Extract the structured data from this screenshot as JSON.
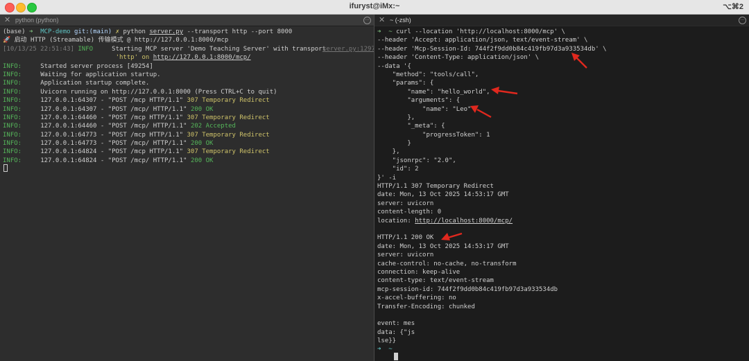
{
  "window": {
    "title": "ifuryst@iMx:~",
    "shortcut": "⌥⌘2"
  },
  "tabs": {
    "left": {
      "close": "✕",
      "label": "python (python)",
      "more": "···"
    },
    "right": {
      "close": "✕",
      "label": "~ (-zsh)",
      "more": "···"
    }
  },
  "left": {
    "cmd": {
      "env": "(base)",
      "arrow": "➜",
      "dir": "MCP-demo",
      "git": "git:(main)",
      "mark": "✗",
      "command": "python",
      "script": "server.py",
      "args": "--transport http --port 8000"
    },
    "banner": "🚀 启动 HTTP (Streamable) 传输模式 @ http://127.0.0.1:8000/mcp",
    "log_ts": "[10/13/25 22:51:43]",
    "log_level": "INFO",
    "log_msg": "Starting MCP server 'Demo Teaching Server' with transport",
    "log_src": "server.py:1297",
    "log_msg2_prefix": "'http' on ",
    "log_msg2_url": "http://127.0.0.1:8000/mcp/",
    "info_label": "INFO:",
    "info_lines": [
      "Started server process [49254]",
      "Waiting for application startup.",
      "Application startup complete.",
      "Uvicorn running on http://127.0.0.1:8000 (Press CTRL+C to quit)",
      "127.0.0.1:64307 - \"POST /mcp HTTP/1.1\" 307 Temporary Redirect",
      "127.0.0.1:64307 - \"POST /mcp/ HTTP/1.1\" 200 OK",
      "127.0.0.1:64460 - \"POST /mcp HTTP/1.1\" 307 Temporary Redirect",
      "127.0.0.1:64460 - \"POST /mcp/ HTTP/1.1\" 202 Accepted",
      "127.0.0.1:64773 - \"POST /mcp HTTP/1.1\" 307 Temporary Redirect",
      "127.0.0.1:64773 - \"POST /mcp/ HTTP/1.1\" 200 OK",
      "127.0.0.1:64824 - \"POST /mcp HTTP/1.1\" 307 Temporary Redirect",
      "127.0.0.1:64824 - \"POST /mcp/ HTTP/1.1\" 200 OK"
    ]
  },
  "right": {
    "prompt": "➜  ~",
    "lines": [
      "curl --location 'http://localhost:8000/mcp' \\",
      "--header 'Accept: application/json, text/event-stream' \\",
      "--header 'Mcp-Session-Id: 744f2f9dd0b84c419fb97d3a933534db' \\",
      "--header 'Content-Type: application/json' \\",
      "--data '{",
      "    \"method\": \"tools/call\",",
      "    \"params\": {",
      "        \"name\": \"hello_world\",",
      "        \"arguments\": {",
      "            \"name\": \"Leo\"",
      "        },",
      "        \"_meta\": {",
      "            \"progressToken\": 1",
      "        }",
      "    },",
      "    \"jsonrpc\": \"2.0\",",
      "    \"id\": 2",
      "}' -i",
      "HTTP/1.1 307 Temporary Redirect",
      "date: Mon, 13 Oct 2025 14:53:17 GMT",
      "server: uvicorn",
      "content-length: 0",
      "location: http://localhost:8000/mcp/",
      "",
      "HTTP/1.1 200 OK",
      "date: Mon, 13 Oct 2025 14:53:17 GMT",
      "server: uvicorn",
      "cache-control: no-cache, no-transform",
      "connection: keep-alive",
      "content-type: text/event-stream",
      "mcp-session-id: 744f2f9dd0b84c419fb97d3a933534db",
      "x-accel-buffering: no",
      "Transfer-Encoding: chunked",
      "",
      "event: mes",
      "data: {\"js",
      "lse}}"
    ],
    "final_prompt": "➜  ~"
  },
  "colors": {
    "accent_red": "#e0281e"
  }
}
